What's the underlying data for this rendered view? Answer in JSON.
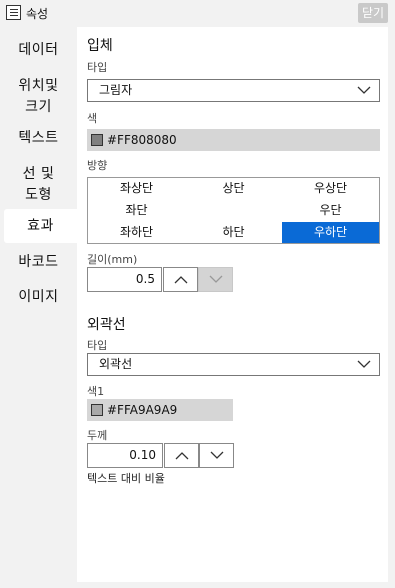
{
  "window": {
    "title": "속성",
    "close_label": "닫기"
  },
  "nav": {
    "items": [
      {
        "label": "데이터"
      },
      {
        "label": "위치및\n크기"
      },
      {
        "label": "텍스트"
      },
      {
        "label": "선 및\n도형"
      },
      {
        "label": "효과"
      },
      {
        "label": "바코드"
      },
      {
        "label": "이미지"
      }
    ],
    "active": "효과"
  },
  "solid": {
    "heading": "입체",
    "type_label": "타입",
    "type_value": "그림자",
    "color_label": "색",
    "color_value": "#FF808080",
    "color_swatch": "#808080",
    "direction_label": "방향",
    "directions": [
      "좌상단",
      "상단",
      "우상단",
      "좌단",
      "",
      "우단",
      "좌하단",
      "하단",
      "우하단"
    ],
    "selected_direction": "우하단",
    "length_label": "길이(mm)",
    "length_value": "0.5"
  },
  "outline": {
    "heading": "외곽선",
    "type_label": "타입",
    "type_value": "외곽선",
    "color_label": "색1",
    "color_value": "#FFA9A9A9",
    "color_swatch": "#a9a9a9",
    "thickness_label": "두께",
    "thickness_value": "0.10",
    "contrast_label": "텍스트 대비 비율"
  },
  "colors": {
    "accent": "#0a6ad6",
    "panel_bg": "#ffffff",
    "window_bg": "#f2f2f2"
  }
}
